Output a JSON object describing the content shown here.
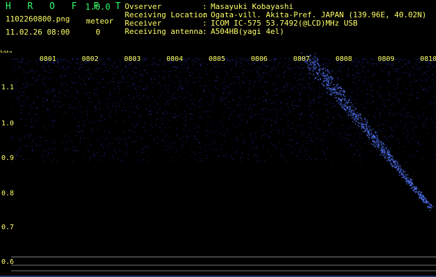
{
  "header": {
    "app_title": "H R O F F T",
    "app_version": "1.0.0",
    "filename": "1102260800.png",
    "datetime": "11.02.26 08:00",
    "meteor_label": "meteor",
    "meteor_count": "0",
    "info": [
      {
        "key": "Ovserver",
        "value": "Masayuki Kobayashi"
      },
      {
        "key": "Receiving Location",
        "value": "Ogata-vill. Akita-Pref. JAPAN (139.96E, 40.02N)"
      },
      {
        "key": "Receiver",
        "value": "ICOM IC-575 53.7492(@LCD)MHz USB"
      },
      {
        "key": "Receiving antenna",
        "value": "A504HB(yagi 4el)"
      }
    ]
  },
  "axis": {
    "y_unit": "kHz",
    "y_ticks": [
      "1.1",
      "1.0",
      "0.9",
      "0.8",
      "0.7",
      "0.6"
    ],
    "x_ticks": [
      "0801",
      "0802",
      "0803",
      "0804",
      "0805",
      "0806",
      "0807",
      "0808",
      "0809",
      "0810"
    ]
  },
  "colors": {
    "text": "#ffff66",
    "title": "#33ff66",
    "noise": "#2233cc",
    "signal": "#4466ff"
  }
}
